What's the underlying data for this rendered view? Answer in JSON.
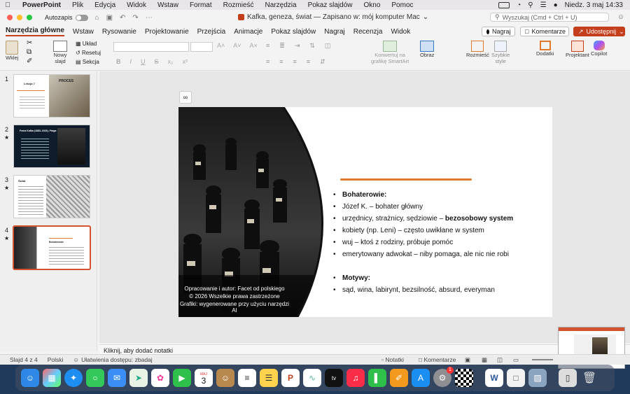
{
  "menubar": {
    "app_name": "PowerPoint",
    "items": [
      "Plik",
      "Edycja",
      "Widok",
      "Wstaw",
      "Format",
      "Rozmieść",
      "Narzędzia",
      "Pokaz slajdów",
      "Okno",
      "Pomoc"
    ],
    "datetime": "Niedz. 3 maj  14:33"
  },
  "titlebar": {
    "autosave_label": "Autozapis",
    "document_title": "Kafka, geneza, świat — Zapisano w: mój komputer Mac",
    "search_placeholder": "Wyszukaj (Cmd + Ctrl + U)"
  },
  "tabs": [
    "Narzędzia główne",
    "Wstaw",
    "Rysowanie",
    "Projektowanie",
    "Przejścia",
    "Animacje",
    "Pokaz slajdów",
    "Nagraj",
    "Recenzja",
    "Widok"
  ],
  "ribbon_buttons": {
    "record": "Nagraj",
    "comments": "Komentarze",
    "share": "Udostępnij"
  },
  "ribbon": {
    "paste": "Wklej",
    "new_slide": "Nowy\nslajd",
    "layout": "Układ",
    "reset": "Resetuj",
    "section": "Sekcja",
    "smartart": "Konwertuj na\ngrafikę SmartArt",
    "picture": "Obraz",
    "arrange": "Rozmieść",
    "quick_styles": "Szybkie\nstyle",
    "addins": "Dodatki",
    "designer": "Projektant",
    "copilot": "Copilot"
  },
  "slides": [
    {
      "num": "1",
      "star": false,
      "title": "Lekcja 7",
      "subtitle": "PROCES"
    },
    {
      "num": "2",
      "star": true,
      "title": "Franz Kafka (1883–1924), Praga"
    },
    {
      "num": "3",
      "star": true,
      "title": "Świat"
    },
    {
      "num": "4",
      "star": true,
      "title": "Bohaterowie"
    }
  ],
  "current_slide": {
    "bullets": [
      {
        "bold": "Bohaterowie:",
        "text": ""
      },
      {
        "bold": "",
        "text": "Józef K. – bohater główny"
      },
      {
        "bold": "bezosobowy system",
        "text": "urzędnicy, strażnicy, sędziowie – "
      },
      {
        "bold": "",
        "text": "kobiety (np. Leni) – często uwikłane w system"
      },
      {
        "bold": "",
        "text": "wuj – ktoś z rodziny, próbuje pomóc"
      },
      {
        "bold": "",
        "text": "emerytowany adwokat – niby pomaga, ale nic nie robi"
      },
      {
        "bold": "Motywy:",
        "text": ""
      },
      {
        "bold": "",
        "text": "sąd, wina, labirynt, bezsilność, absurd, everyman"
      }
    ],
    "credit_lines": [
      "Opracowanie i autor: Facet od polskiego",
      "© 2026 Wszelkie prawa zastrzeżone",
      "Grafiki: wygenerowane przy użyciu narzędzi AI"
    ],
    "accent_color": "#e07b2e"
  },
  "notes_placeholder": "Kliknij, aby dodać notatki",
  "status": {
    "slide_counter": "Slajd 4 z 4",
    "language": "Polski",
    "accessibility": "Ułatwienia dostępu: zbadaj",
    "notes": "Notatki",
    "comments": "Komentarze"
  },
  "dock": {
    "calendar_month": "MAJ",
    "calendar_day": "3",
    "badge": "1",
    "tv_label": "tv"
  }
}
